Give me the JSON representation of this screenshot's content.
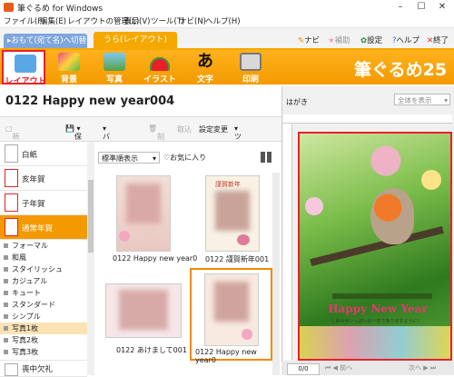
{
  "titlebar": {
    "title": "筆ぐるめ for Windows"
  },
  "menu": [
    "ファイル(F)",
    "編集(E)",
    "レイアウトの管理(L)",
    "表示(V)",
    "ツール(T)",
    "ナビ(N)",
    "ヘルプ(H)"
  ],
  "tabs": {
    "front": "おもて(宛て名)へ切替",
    "back": "うら(レイアウト)"
  },
  "topnav": {
    "navi": "ナビ",
    "assist": "補助",
    "settings": "設定",
    "help": "ヘルプ",
    "exit": "終了"
  },
  "toolbar": [
    {
      "label": "レイアウト",
      "icon": "layout-icon",
      "active": true
    },
    {
      "label": "背景",
      "icon": "background-icon"
    },
    {
      "label": "写真",
      "icon": "photo-icon"
    },
    {
      "label": "イラスト",
      "icon": "illustration-icon"
    },
    {
      "label": "文字",
      "icon": "text-icon"
    },
    {
      "label": "印刷",
      "icon": "printer-icon"
    }
  ],
  "brand": "筆ぐるめ25",
  "header": {
    "title": "0122  Happy new year004"
  },
  "subtool": {
    "new": "新規レイアウト",
    "save": "保存",
    "backup": "バックアップ",
    "delete": "削除",
    "import": "取込",
    "settings_change": "設定変更",
    "tools": "ツール"
  },
  "sidebar": {
    "big": [
      {
        "label": "白紙"
      },
      {
        "label": "亥年賀"
      },
      {
        "label": "子年賀"
      },
      {
        "label": "通常年賀",
        "selected": true
      }
    ],
    "small": [
      {
        "label": "フォーマル"
      },
      {
        "label": "和風"
      },
      {
        "label": "スタイリッシュ"
      },
      {
        "label": "カジュアル"
      },
      {
        "label": "キュート"
      },
      {
        "label": "スタンダード"
      },
      {
        "label": "シンプル"
      },
      {
        "label": "写真1枚",
        "selected": true
      },
      {
        "label": "写真2枚"
      },
      {
        "label": "写真3枚"
      }
    ],
    "bottom": {
      "label": "喪中欠礼"
    }
  },
  "main": {
    "sort": "標準順表示",
    "favorites": "お気に入り",
    "thumbs": [
      {
        "caption": "0122  Happy new year0"
      },
      {
        "caption": "0122  謹賀新年001"
      },
      {
        "caption": "0122  あけまして001"
      },
      {
        "caption": "0122  Happy new year0",
        "selected": true
      }
    ]
  },
  "preview": {
    "type": "はがき",
    "view": "全体を表示",
    "card_text": "Happy New Year",
    "card_subtext": "しあわせいっぱいの一年でありますように!",
    "page": "0/0",
    "prev": "前へ",
    "next": "次へ"
  }
}
